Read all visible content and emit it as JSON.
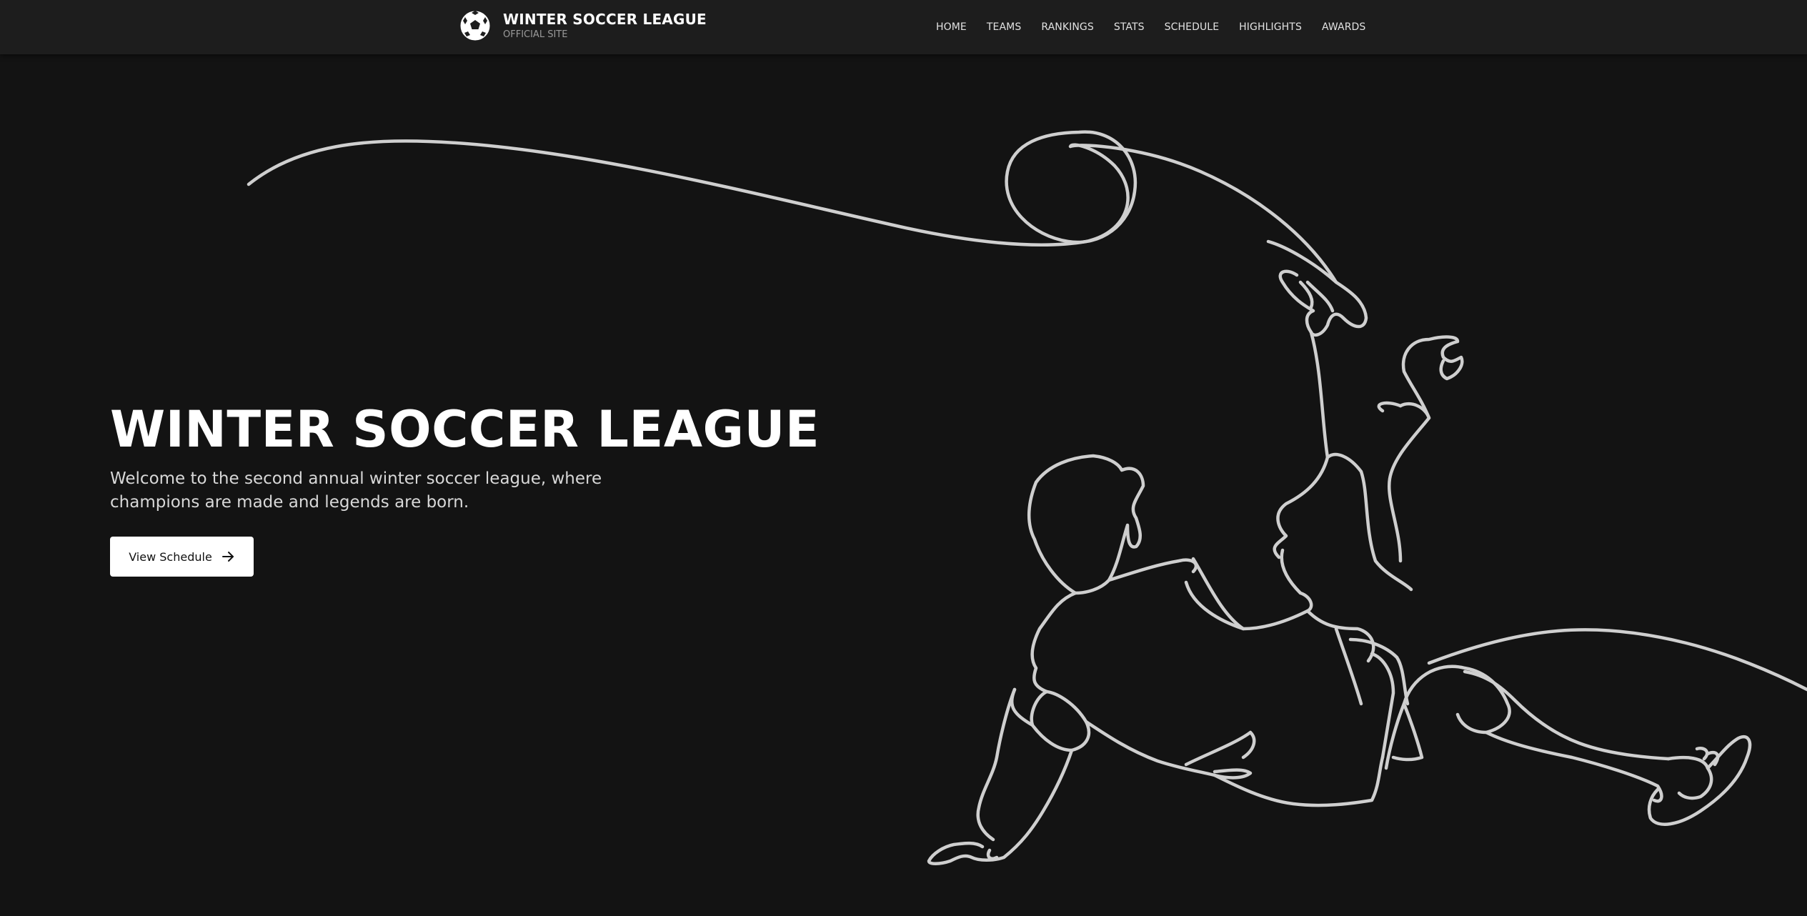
{
  "brand": {
    "title": "WINTER SOCCER LEAGUE",
    "subtitle": "OFFICIAL SITE",
    "logo_icon": "soccer-ball-icon"
  },
  "nav": {
    "items": [
      "HOME",
      "TEAMS",
      "RANKINGS",
      "STATS",
      "SCHEDULE",
      "HIGHLIGHTS",
      "AWARDS"
    ]
  },
  "hero": {
    "title": "WINTER SOCCER LEAGUE",
    "text": "Welcome to the second annual winter soccer league, where champions are made and legends are born.",
    "cta_label": "View Schedule",
    "cta_icon": "arrow-right-icon",
    "illustration": "soccer-player-line-art"
  },
  "colors": {
    "background": "#131313",
    "topbar": "#1d1d1d",
    "text": "#ffffff",
    "line_art": "#cfcfcf"
  }
}
